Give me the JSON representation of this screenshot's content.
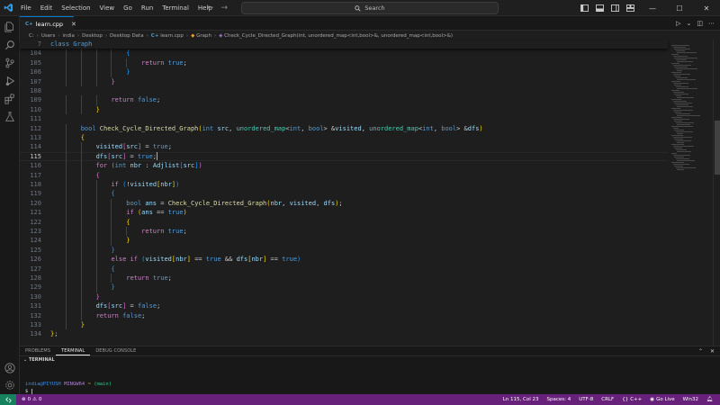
{
  "titlebar": {
    "menu": [
      "File",
      "Edit",
      "Selection",
      "View",
      "Go",
      "Run",
      "Terminal",
      "Help"
    ],
    "search_label": "Search"
  },
  "tab": {
    "filename": "learn.cpp",
    "lang_badge": "C+"
  },
  "breadcrumb": [
    "C:",
    "Users",
    "india",
    "Desktop",
    "Desktop Data",
    "learn.cpp",
    "Graph",
    "Check_Cycle_Directed_Graph(int, unordered_map<int,bool>&, unordered_map<int,bool>&)"
  ],
  "sticky": {
    "line": "7",
    "code": "class Graph"
  },
  "editor": {
    "active_line": "115",
    "lines": [
      {
        "n": "104",
        "indent": 5,
        "segments": [
          [
            "b3",
            "{"
          ]
        ]
      },
      {
        "n": "105",
        "indent": 6,
        "segments": [
          [
            "c",
            "return"
          ],
          [
            "p",
            " "
          ],
          [
            "k",
            "true"
          ],
          [
            "p",
            ";"
          ]
        ]
      },
      {
        "n": "106",
        "indent": 5,
        "segments": [
          [
            "b3",
            "}"
          ]
        ]
      },
      {
        "n": "107",
        "indent": 4,
        "segments": [
          [
            "b2",
            "}"
          ]
        ]
      },
      {
        "n": "108",
        "indent": 0,
        "segments": []
      },
      {
        "n": "109",
        "indent": 4,
        "segments": [
          [
            "c",
            "return"
          ],
          [
            "p",
            " "
          ],
          [
            "k",
            "false"
          ],
          [
            "p",
            ";"
          ]
        ]
      },
      {
        "n": "110",
        "indent": 3,
        "segments": [
          [
            "b1",
            "}"
          ]
        ]
      },
      {
        "n": "111",
        "indent": 0,
        "segments": []
      },
      {
        "n": "112",
        "indent": 2,
        "segments": [
          [
            "k",
            "bool"
          ],
          [
            "p",
            " "
          ],
          [
            "f",
            "Check_Cycle_Directed_Graph"
          ],
          [
            "b1",
            "("
          ],
          [
            "k",
            "int"
          ],
          [
            "p",
            " "
          ],
          [
            "v",
            "src"
          ],
          [
            "p",
            ", "
          ],
          [
            "t",
            "unordered_map"
          ],
          [
            "p",
            "<"
          ],
          [
            "k",
            "int"
          ],
          [
            "p",
            ", "
          ],
          [
            "k",
            "bool"
          ],
          [
            "p",
            "> &"
          ],
          [
            "v",
            "visited"
          ],
          [
            "p",
            ", "
          ],
          [
            "t",
            "unordered_map"
          ],
          [
            "p",
            "<"
          ],
          [
            "k",
            "int"
          ],
          [
            "p",
            ", "
          ],
          [
            "k",
            "bool"
          ],
          [
            "p",
            "> &"
          ],
          [
            "v",
            "dfs"
          ],
          [
            "b1",
            ")"
          ]
        ]
      },
      {
        "n": "113",
        "indent": 2,
        "segments": [
          [
            "b1",
            "{"
          ]
        ]
      },
      {
        "n": "114",
        "indent": 3,
        "segments": [
          [
            "v",
            "visited"
          ],
          [
            "b2",
            "["
          ],
          [
            "v",
            "src"
          ],
          [
            "b2",
            "]"
          ],
          [
            "p",
            " = "
          ],
          [
            "k",
            "true"
          ],
          [
            "p",
            ";"
          ]
        ]
      },
      {
        "n": "115",
        "indent": 3,
        "segments": [
          [
            "v",
            "dfs"
          ],
          [
            "b2",
            "["
          ],
          [
            "v",
            "src"
          ],
          [
            "b2",
            "]"
          ],
          [
            "p",
            " = "
          ],
          [
            "k",
            "true"
          ],
          [
            "p",
            ";"
          ]
        ],
        "cursor": true
      },
      {
        "n": "116",
        "indent": 3,
        "segments": [
          [
            "c",
            "for"
          ],
          [
            "p",
            " "
          ],
          [
            "b2",
            "("
          ],
          [
            "k",
            "int"
          ],
          [
            "p",
            " "
          ],
          [
            "v",
            "nbr"
          ],
          [
            "p",
            " : "
          ],
          [
            "v",
            "Adjlist"
          ],
          [
            "b3",
            "["
          ],
          [
            "v",
            "src"
          ],
          [
            "b3",
            "]"
          ],
          [
            "b2",
            ")"
          ]
        ]
      },
      {
        "n": "117",
        "indent": 3,
        "segments": [
          [
            "b2",
            "{"
          ]
        ]
      },
      {
        "n": "118",
        "indent": 4,
        "segments": [
          [
            "c",
            "if"
          ],
          [
            "p",
            " "
          ],
          [
            "b3",
            "("
          ],
          [
            "p",
            "!"
          ],
          [
            "v",
            "visited"
          ],
          [
            "b1",
            "["
          ],
          [
            "v",
            "nbr"
          ],
          [
            "b1",
            "]"
          ],
          [
            "b3",
            ")"
          ]
        ]
      },
      {
        "n": "119",
        "indent": 4,
        "segments": [
          [
            "b3",
            "{"
          ]
        ]
      },
      {
        "n": "120",
        "indent": 5,
        "segments": [
          [
            "k",
            "bool"
          ],
          [
            "p",
            " "
          ],
          [
            "v",
            "ans"
          ],
          [
            "p",
            " = "
          ],
          [
            "f",
            "Check_Cycle_Directed_Graph"
          ],
          [
            "b1",
            "("
          ],
          [
            "v",
            "nbr"
          ],
          [
            "p",
            ", "
          ],
          [
            "v",
            "visited"
          ],
          [
            "p",
            ", "
          ],
          [
            "v",
            "dfs"
          ],
          [
            "b1",
            ")"
          ],
          [
            "p",
            ";"
          ]
        ]
      },
      {
        "n": "121",
        "indent": 5,
        "segments": [
          [
            "c",
            "if"
          ],
          [
            "p",
            " "
          ],
          [
            "b1",
            "("
          ],
          [
            "v",
            "ans"
          ],
          [
            "p",
            " == "
          ],
          [
            "k",
            "true"
          ],
          [
            "b1",
            ")"
          ]
        ]
      },
      {
        "n": "122",
        "indent": 5,
        "segments": [
          [
            "b1",
            "{"
          ]
        ]
      },
      {
        "n": "123",
        "indent": 6,
        "segments": [
          [
            "c",
            "return"
          ],
          [
            "p",
            " "
          ],
          [
            "k",
            "true"
          ],
          [
            "p",
            ";"
          ]
        ]
      },
      {
        "n": "124",
        "indent": 5,
        "segments": [
          [
            "b1",
            "}"
          ]
        ]
      },
      {
        "n": "125",
        "indent": 4,
        "segments": [
          [
            "b3",
            "}"
          ]
        ]
      },
      {
        "n": "126",
        "indent": 4,
        "segments": [
          [
            "c",
            "else"
          ],
          [
            "p",
            " "
          ],
          [
            "c",
            "if"
          ],
          [
            "p",
            " "
          ],
          [
            "b3",
            "("
          ],
          [
            "v",
            "visited"
          ],
          [
            "b1",
            "["
          ],
          [
            "v",
            "nbr"
          ],
          [
            "b1",
            "]"
          ],
          [
            "p",
            " == "
          ],
          [
            "k",
            "true"
          ],
          [
            "p",
            " && "
          ],
          [
            "v",
            "dfs"
          ],
          [
            "b1",
            "["
          ],
          [
            "v",
            "nbr"
          ],
          [
            "b1",
            "]"
          ],
          [
            "p",
            " == "
          ],
          [
            "k",
            "true"
          ],
          [
            "b3",
            ")"
          ]
        ]
      },
      {
        "n": "127",
        "indent": 4,
        "segments": [
          [
            "b3",
            "{"
          ]
        ]
      },
      {
        "n": "128",
        "indent": 5,
        "segments": [
          [
            "c",
            "return"
          ],
          [
            "p",
            " "
          ],
          [
            "k",
            "true"
          ],
          [
            "p",
            ";"
          ]
        ]
      },
      {
        "n": "129",
        "indent": 4,
        "segments": [
          [
            "b3",
            "}"
          ]
        ]
      },
      {
        "n": "130",
        "indent": 3,
        "segments": [
          [
            "b2",
            "}"
          ]
        ]
      },
      {
        "n": "131",
        "indent": 3,
        "segments": [
          [
            "v",
            "dfs"
          ],
          [
            "b2",
            "["
          ],
          [
            "v",
            "src"
          ],
          [
            "b2",
            "]"
          ],
          [
            "p",
            " = "
          ],
          [
            "k",
            "false"
          ],
          [
            "p",
            ";"
          ]
        ]
      },
      {
        "n": "132",
        "indent": 3,
        "segments": [
          [
            "c",
            "return"
          ],
          [
            "p",
            " "
          ],
          [
            "k",
            "false"
          ],
          [
            "p",
            ";"
          ]
        ]
      },
      {
        "n": "133",
        "indent": 2,
        "segments": [
          [
            "b1",
            "}"
          ]
        ]
      },
      {
        "n": "134",
        "indent": 0,
        "segments": [
          [
            "b1",
            "}"
          ],
          [
            "p",
            ";"
          ]
        ]
      }
    ]
  },
  "panel": {
    "tabs": [
      "PROBLEMS",
      "TERMINAL",
      "DEBUG CONSOLE"
    ],
    "active_tab": "TERMINAL",
    "terminal_header": "TERMINAL",
    "prompt_user": "india@PIYUSH",
    "prompt_env": "MINGW64",
    "prompt_path": "~",
    "prompt_branch": "(main)",
    "prompt_symbol": "$"
  },
  "statusbar": {
    "errors": "0",
    "warnings": "0",
    "position": "Ln 115, Col 23",
    "spaces": "Spaces: 4",
    "encoding": "UTF-8",
    "eol": "CRLF",
    "language": "C++",
    "golive": "Go Live",
    "platform": "Win32"
  },
  "colors": {
    "statusbar": "#68217a",
    "remote": "#16825d",
    "tab_accent": "#0078d4"
  }
}
